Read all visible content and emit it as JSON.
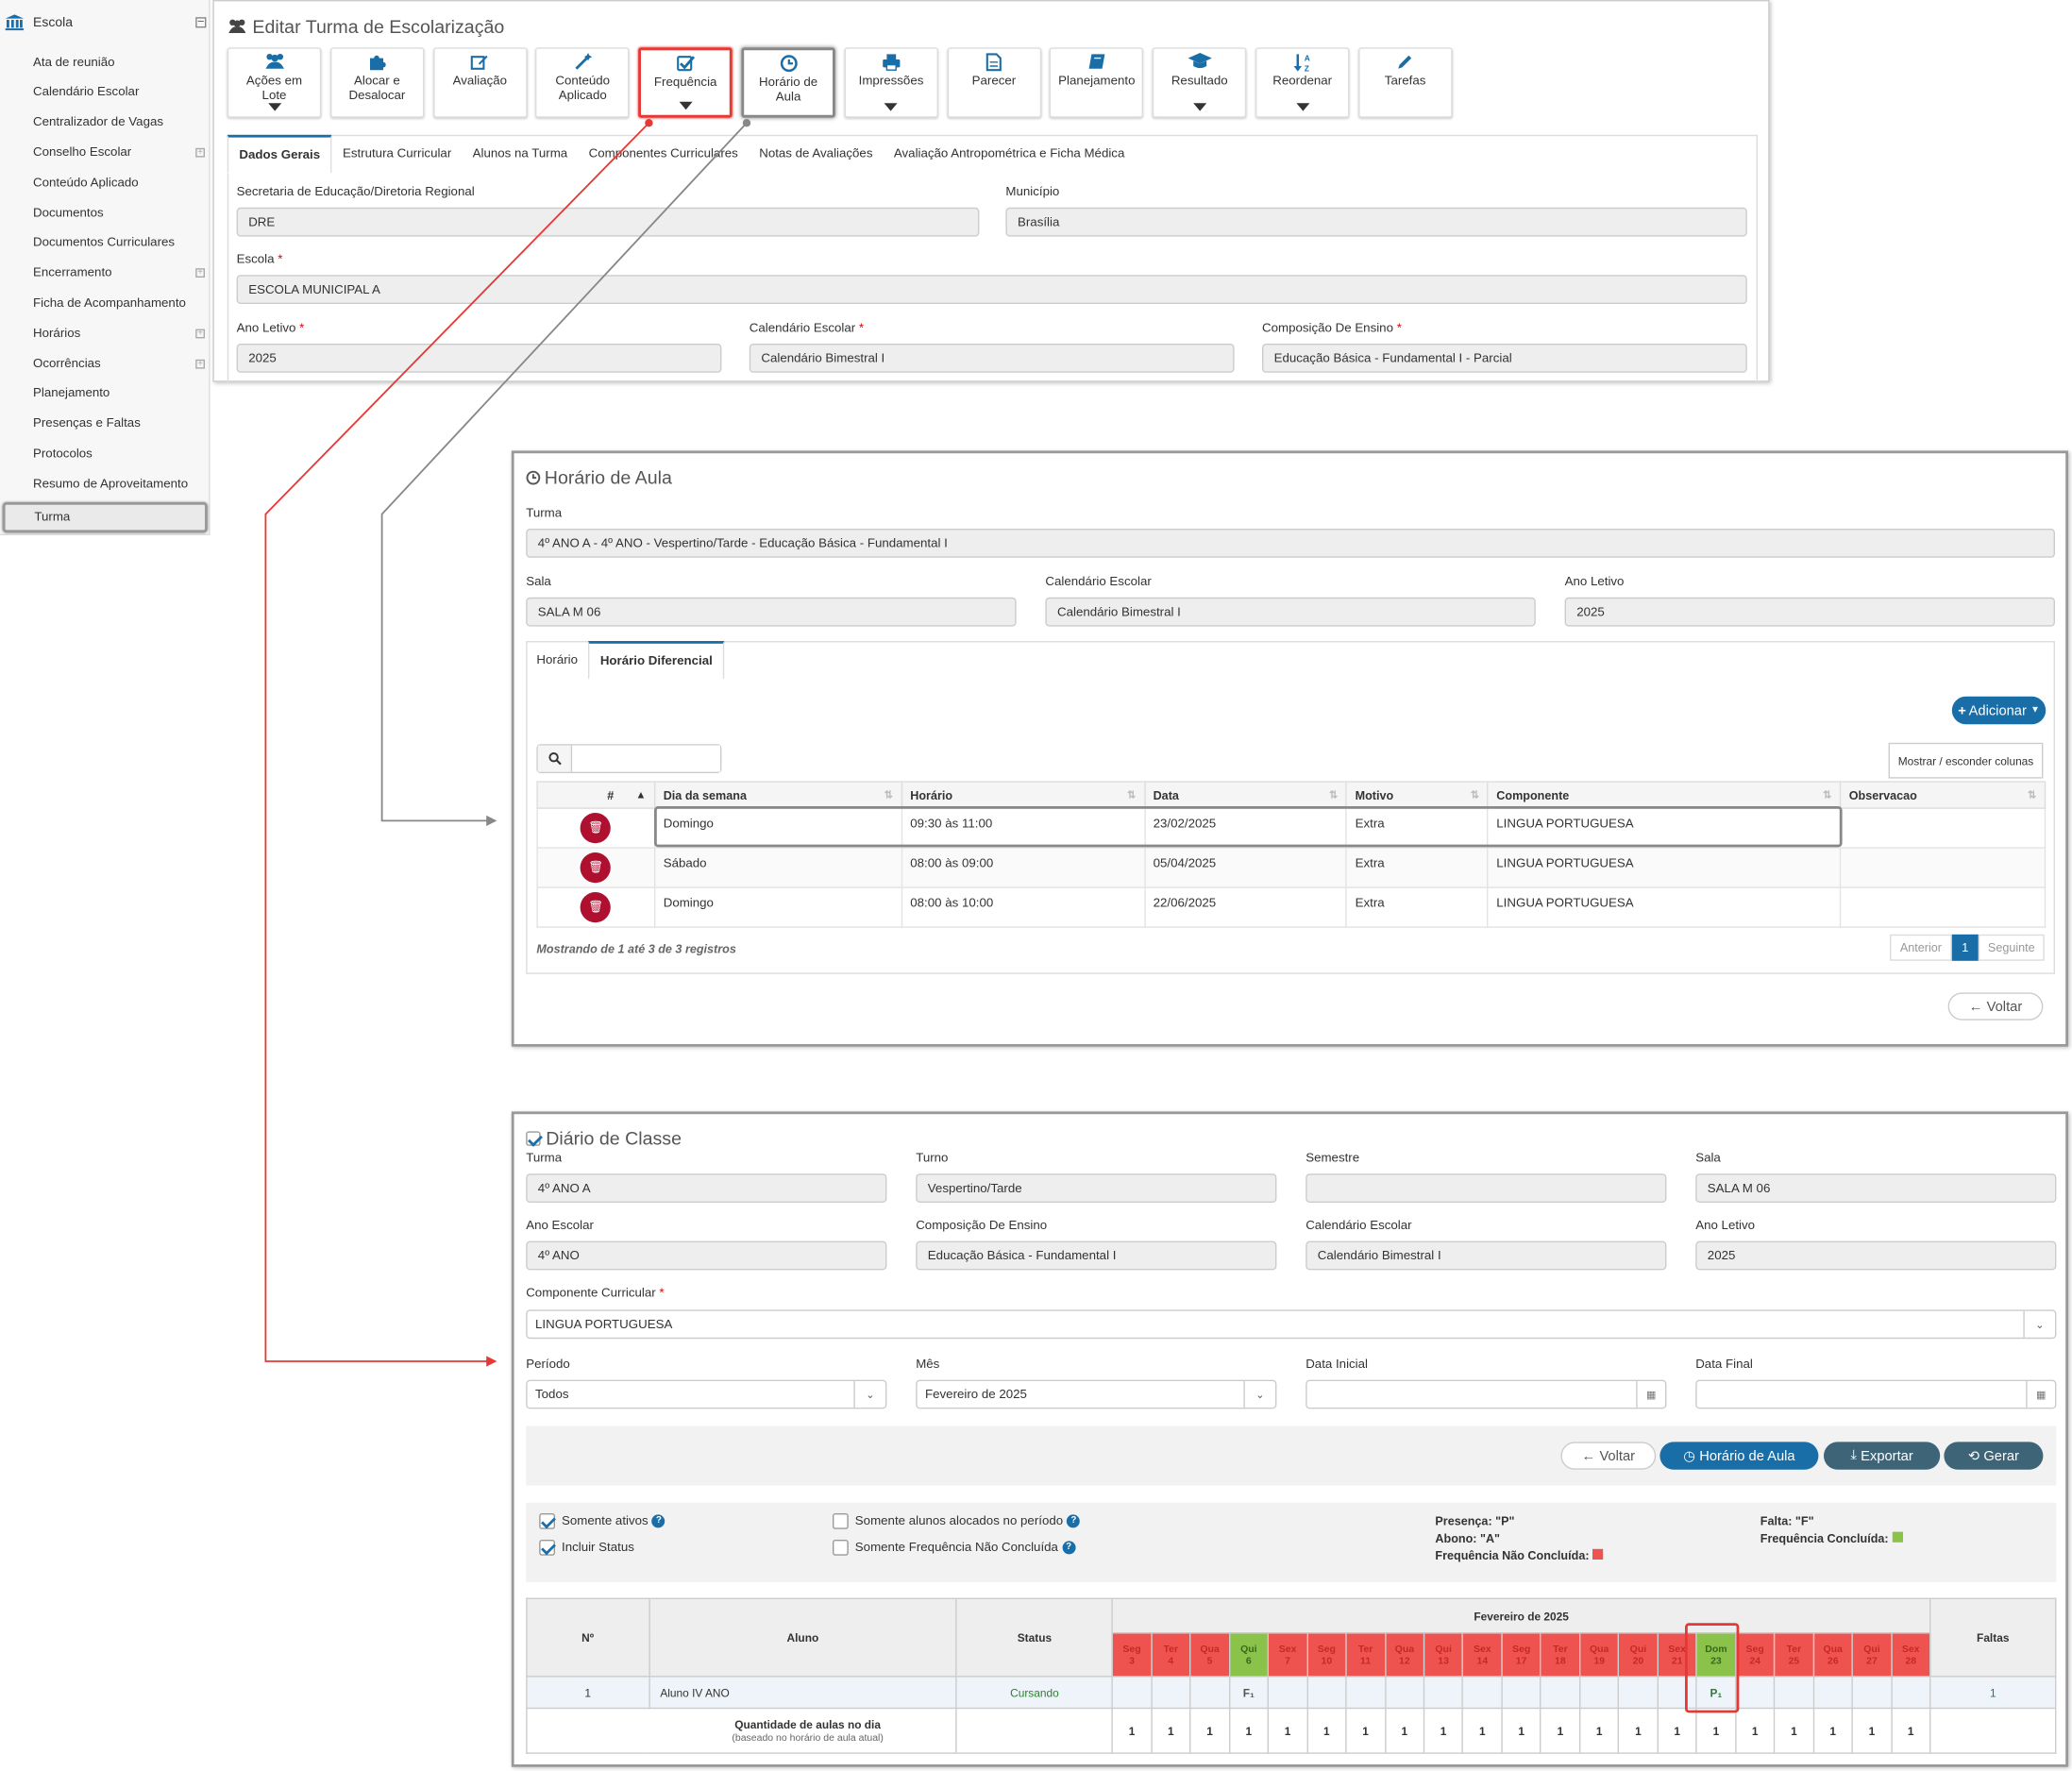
{
  "sidebar": {
    "header": "Escola",
    "items": [
      {
        "label": "Ata de reunião",
        "expandable": false
      },
      {
        "label": "Calendário Escolar",
        "expandable": false
      },
      {
        "label": "Centralizador de Vagas",
        "expandable": false
      },
      {
        "label": "Conselho Escolar",
        "expandable": true
      },
      {
        "label": "Conteúdo Aplicado",
        "expandable": false
      },
      {
        "label": "Documentos",
        "expandable": false
      },
      {
        "label": "Documentos Curriculares",
        "expandable": false
      },
      {
        "label": "Encerramento",
        "expandable": true
      },
      {
        "label": "Ficha de Acompanhamento",
        "expandable": false
      },
      {
        "label": "Horários",
        "expandable": true
      },
      {
        "label": "Ocorrências",
        "expandable": true
      },
      {
        "label": "Planejamento",
        "expandable": false
      },
      {
        "label": "Presenças e Faltas",
        "expandable": false
      },
      {
        "label": "Protocolos",
        "expandable": false
      },
      {
        "label": "Resumo de Aproveitamento",
        "expandable": false
      }
    ],
    "selected": "Turma"
  },
  "edit": {
    "title": "Editar Turma de Escolarização",
    "toolbar": [
      {
        "l1": "Ações em",
        "l2": "Lote",
        "icon": "users-icon",
        "caret": true
      },
      {
        "l1": "Alocar e",
        "l2": "Desalocar",
        "icon": "puzzle-icon",
        "caret": false
      },
      {
        "l1": "Avaliação",
        "l2": "",
        "icon": "edit-icon",
        "caret": false
      },
      {
        "l1": "Conteúdo",
        "l2": "Aplicado",
        "icon": "magic-wand-icon",
        "caret": false
      },
      {
        "l1": "Frequência",
        "l2": "",
        "icon": "check-square-icon",
        "caret": true
      },
      {
        "l1": "Horário de",
        "l2": "Aula",
        "icon": "clock-icon",
        "caret": false
      },
      {
        "l1": "Impressões",
        "l2": "",
        "icon": "print-icon",
        "caret": true
      },
      {
        "l1": "Parecer",
        "l2": "",
        "icon": "file-icon",
        "caret": false
      },
      {
        "l1": "Planejamento",
        "l2": "",
        "icon": "book-icon",
        "caret": false
      },
      {
        "l1": "Resultado",
        "l2": "",
        "icon": "graduation-cap-icon",
        "caret": true
      },
      {
        "l1": "Reordenar",
        "l2": "",
        "icon": "sort-alpha-icon",
        "caret": true
      },
      {
        "l1": "Tarefas",
        "l2": "",
        "icon": "pencil-icon",
        "caret": false
      }
    ],
    "tabs": [
      "Dados Gerais",
      "Estrutura Curricular",
      "Alunos na Turma",
      "Componentes Curriculares",
      "Notas de Avaliações",
      "Avaliação Antropométrica e Ficha Médica"
    ],
    "fields": {
      "secretaria_label": "Secretaria de Educação/Diretoria Regional",
      "secretaria": "DRE",
      "municipio_label": "Município",
      "municipio": "Brasília",
      "escola_label": "Escola",
      "escola": "ESCOLA MUNICIPAL A",
      "ano_label": "Ano Letivo",
      "ano": "2025",
      "calendario_label": "Calendário Escolar",
      "calendario": "Calendário Bimestral I",
      "composicao_label": "Composição De Ensino",
      "composicao": "Educação Básica - Fundamental I - Parcial"
    }
  },
  "horario": {
    "title": "Horário de Aula",
    "turma_label": "Turma",
    "turma": "4º ANO A - 4º ANO - Vespertino/Tarde - Educação Básica - Fundamental I",
    "sala_label": "Sala",
    "sala": "SALA M 06",
    "calendario_label": "Calendário Escolar",
    "calendario": "Calendário Bimestral I",
    "ano_label": "Ano Letivo",
    "ano": "2025",
    "tabs": [
      "Horário",
      "Horário Diferencial"
    ],
    "add_button": "Adicionar",
    "columns_button": "Mostrar / esconder colunas",
    "headers": [
      "#",
      "Dia da semana",
      "Horário",
      "Data",
      "Motivo",
      "Componente",
      "Observacao"
    ],
    "rows": [
      {
        "dia": "Domingo",
        "horario": "09:30 às 11:00",
        "data": "23/02/2025",
        "motivo": "Extra",
        "componente": "LINGUA PORTUGUESA",
        "obs": ""
      },
      {
        "dia": "Sábado",
        "horario": "08:00 às 09:00",
        "data": "05/04/2025",
        "motivo": "Extra",
        "componente": "LINGUA PORTUGUESA",
        "obs": ""
      },
      {
        "dia": "Domingo",
        "horario": "08:00 às 10:00",
        "data": "22/06/2025",
        "motivo": "Extra",
        "componente": "LINGUA PORTUGUESA",
        "obs": ""
      }
    ],
    "info": "Mostrando de 1 até 3 de 3 registros",
    "pagination": {
      "prev": "Anterior",
      "page": "1",
      "next": "Seguinte"
    },
    "back": "Voltar"
  },
  "diario": {
    "title": "Diário de Classe",
    "turma_label": "Turma",
    "turma": "4º ANO A",
    "turno_label": "Turno",
    "turno": "Vespertino/Tarde",
    "semestre_label": "Semestre",
    "semestre": "",
    "sala_label": "Sala",
    "sala": "SALA M 06",
    "ano_escolar_label": "Ano Escolar",
    "ano_escolar": "4º ANO",
    "composicao_label": "Composição De Ensino",
    "composicao": "Educação Básica - Fundamental I",
    "calendario_label": "Calendário Escolar",
    "calendario": "Calendário Bimestral I",
    "ano_letivo_label": "Ano Letivo",
    "ano_letivo": "2025",
    "componente_label": "Componente Curricular",
    "componente": "LINGUA PORTUGUESA",
    "periodo_label": "Período",
    "periodo": "Todos",
    "mes_label": "Mês",
    "mes": "Fevereiro de 2025",
    "data_inicial_label": "Data Inicial",
    "data_inicial": "",
    "data_final_label": "Data Final",
    "data_final": "",
    "buttons": {
      "voltar": "Voltar",
      "horario": "Horário de Aula",
      "exportar": "Exportar",
      "gerar": "Gerar"
    },
    "checks": [
      {
        "label": "Somente ativos",
        "checked": true
      },
      {
        "label": "Incluir Status",
        "checked": true
      },
      {
        "label": "Somente alunos alocados no período",
        "checked": false
      },
      {
        "label": "Somente Frequência Não Concluída",
        "checked": false
      }
    ],
    "legend": {
      "presenca": "Presença: \"P\"",
      "abono": "Abono: \"A\"",
      "nao_concluida": "Frequência Não Concluída:",
      "falta": "Falta: \"F\"",
      "concluida": "Frequência Concluída:"
    },
    "colors": {
      "red": "#ef5350",
      "green": "#8bc34a",
      "blue": "#1a6ea8"
    },
    "table": {
      "month": "Fevereiro de 2025",
      "h_num": "Nº",
      "h_aluno": "Aluno",
      "h_status": "Status",
      "h_faltas": "Faltas",
      "days": [
        {
          "w": "Seg",
          "d": "3",
          "c": "red"
        },
        {
          "w": "Ter",
          "d": "4",
          "c": "red"
        },
        {
          "w": "Qua",
          "d": "5",
          "c": "red"
        },
        {
          "w": "Qui",
          "d": "6",
          "c": "green"
        },
        {
          "w": "Sex",
          "d": "7",
          "c": "red"
        },
        {
          "w": "Seg",
          "d": "10",
          "c": "red"
        },
        {
          "w": "Ter",
          "d": "11",
          "c": "red"
        },
        {
          "w": "Qua",
          "d": "12",
          "c": "red"
        },
        {
          "w": "Qui",
          "d": "13",
          "c": "red"
        },
        {
          "w": "Sex",
          "d": "14",
          "c": "red"
        },
        {
          "w": "Seg",
          "d": "17",
          "c": "red"
        },
        {
          "w": "Ter",
          "d": "18",
          "c": "red"
        },
        {
          "w": "Qua",
          "d": "19",
          "c": "red"
        },
        {
          "w": "Qui",
          "d": "20",
          "c": "red"
        },
        {
          "w": "Sex",
          "d": "21",
          "c": "red"
        },
        {
          "w": "Dom",
          "d": "23",
          "c": "green"
        },
        {
          "w": "Seg",
          "d": "24",
          "c": "red"
        },
        {
          "w": "Ter",
          "d": "25",
          "c": "red"
        },
        {
          "w": "Qua",
          "d": "26",
          "c": "red"
        },
        {
          "w": "Qui",
          "d": "27",
          "c": "red"
        },
        {
          "w": "Sex",
          "d": "28",
          "c": "red"
        }
      ],
      "student": {
        "num": "1",
        "name": "Aluno IV ANO",
        "status": "Cursando",
        "marks": [
          "",
          "",
          "",
          "F₁",
          "",
          "",
          "",
          "",
          "",
          "",
          "",
          "",
          "",
          "",
          "",
          "P₁",
          "",
          "",
          "",
          "",
          ""
        ],
        "faltas": "1"
      },
      "qty_label": "Quantidade de aulas no dia",
      "qty_sub": "(baseado no horário de aula atual)",
      "qty": [
        "1",
        "1",
        "1",
        "1",
        "1",
        "1",
        "1",
        "1",
        "1",
        "1",
        "1",
        "1",
        "1",
        "1",
        "1",
        "1",
        "1",
        "1",
        "1",
        "1",
        "1"
      ]
    }
  }
}
